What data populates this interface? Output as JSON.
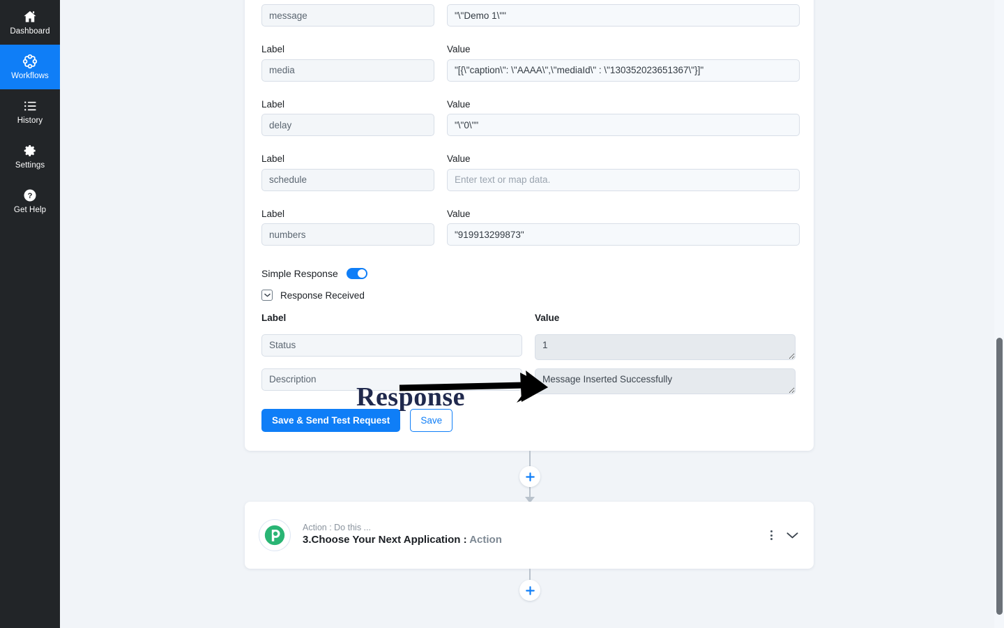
{
  "sidebar": {
    "items": [
      {
        "label": "Dashboard",
        "icon": "home-icon",
        "active": false
      },
      {
        "label": "Workflows",
        "icon": "workflows-icon",
        "active": true
      },
      {
        "label": "History",
        "icon": "history-list-icon",
        "active": false
      },
      {
        "label": "Settings",
        "icon": "gear-icon",
        "active": false
      },
      {
        "label": "Get Help",
        "icon": "question-circle-icon",
        "active": false
      }
    ],
    "active_color": "#0f7ef7",
    "background": "#222528"
  },
  "form": {
    "label_header": "Label",
    "value_header": "Value",
    "value_placeholder": "Enter text or map data.",
    "fields": [
      {
        "label": "message",
        "value": "\"\\\"Demo 1\\\"\"",
        "has_header": false
      },
      {
        "label": "media",
        "value": "\"[{\\\"caption\\\": \\\"AAAA\\\",\\\"mediaId\\\" : \\\"130352023651367\\\"}]\"",
        "has_header": true
      },
      {
        "label": "delay",
        "value": "\"\\\"0\\\"\"",
        "has_header": true
      },
      {
        "label": "schedule",
        "value": "",
        "has_header": true
      },
      {
        "label": "numbers",
        "value": "\"919913299873\"",
        "has_header": true
      }
    ]
  },
  "simple_response": {
    "label": "Simple Response",
    "enabled": true
  },
  "response_section": {
    "title": "Response Received",
    "expanded": true,
    "label_header": "Label",
    "value_header": "Value",
    "rows": [
      {
        "label": "Status",
        "value": "1"
      },
      {
        "label": "Description",
        "value": "Message Inserted Successfully"
      }
    ]
  },
  "buttons": {
    "save_and_send": "Save & Send Test Request",
    "save": "Save"
  },
  "annotation": {
    "text": "Response",
    "arrow": "right-arrow",
    "color": "#20294d"
  },
  "action_card": {
    "app_icon": "pabbly-p-logo-icon",
    "app_icon_color": "#2ab574",
    "subtitle": "Action : Do this ...",
    "title": "3.Choose Your Next Application :",
    "title_suffix": "Action",
    "menu_icon": "more-vertical-icon",
    "expand_icon": "chevron-down-icon"
  },
  "connectors": {
    "add_label": "+"
  },
  "colors": {
    "accent": "#0f7ef7",
    "canvas_bg": "#f1f4f8",
    "card_bg": "#ffffff",
    "input_bg": "#f3f6f9",
    "disabled_bg": "#e6eaee"
  }
}
